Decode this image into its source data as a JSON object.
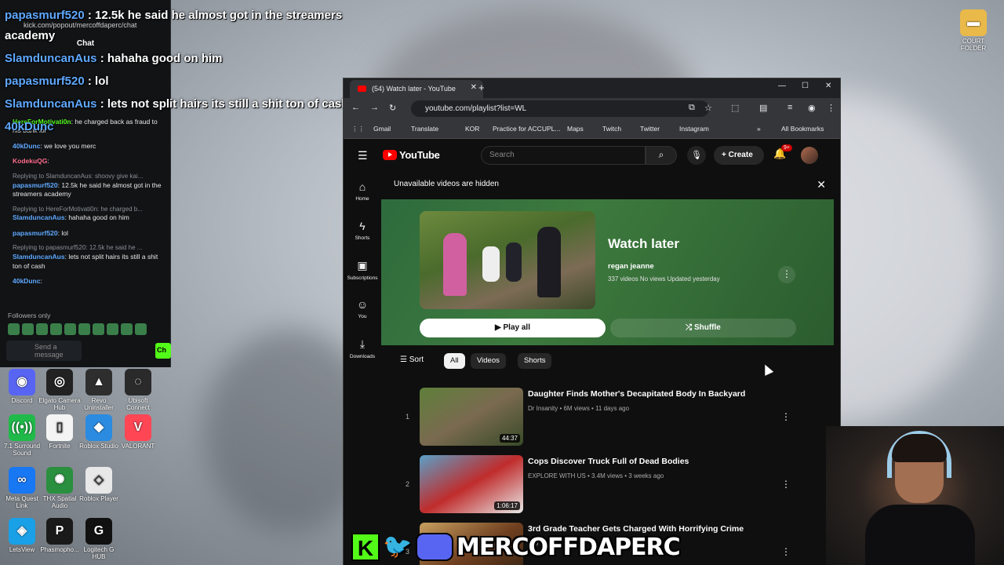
{
  "desktop": {
    "icons": [
      {
        "label": "COURT FOLDER",
        "glyph": "▬",
        "color": "#e9b949"
      },
      {
        "label": "Discord",
        "glyph": "◉",
        "color": "#5865f2"
      },
      {
        "label": "Elgato Camera Hub",
        "glyph": "◎",
        "color": "#222222"
      },
      {
        "label": "Revo Uninstaller",
        "glyph": "▲",
        "color": "#2e2e2e"
      },
      {
        "label": "Ubisoft Connect",
        "glyph": "◌",
        "color": "#2a2a2a"
      },
      {
        "label": "7.1 Surround Sound",
        "glyph": "((•))",
        "color": "#1fba4a"
      },
      {
        "label": "Fortnite",
        "glyph": "▯",
        "color": "#f4f4f4"
      },
      {
        "label": "Roblox Studio",
        "glyph": "◆",
        "color": "#2b8be0"
      },
      {
        "label": "VALORANT",
        "glyph": "V",
        "color": "#ff4655"
      },
      {
        "label": "Meta Quest Link",
        "glyph": "∞",
        "color": "#1877f2"
      },
      {
        "label": "THX Spatial Audio",
        "glyph": "✺",
        "color": "#2a8f3e"
      },
      {
        "label": "Roblox Player",
        "glyph": "◇",
        "color": "#e8e8e8"
      },
      {
        "label": "LetsView",
        "glyph": "◈",
        "color": "#1aa0e6"
      },
      {
        "label": "Phasmopho...",
        "glyph": "P",
        "color": "#1a1a1a"
      },
      {
        "label": "Logitech G HUB",
        "glyph": "G",
        "color": "#111111"
      }
    ]
  },
  "chat_popout": {
    "url": "kick.com/popout/mercoffdaperc/chat",
    "header": "Chat",
    "messages": [
      {
        "reply": "",
        "user": "HereForMotivati0n",
        "user_color": "#53fc18",
        "text": ": he charged back as fraud to his bank lol"
      },
      {
        "reply": "",
        "user": "40kDunc",
        "user_color": "#5fa8ff",
        "text": ": we love you merc"
      },
      {
        "reply": "",
        "user": "KodekuQG",
        "user_color": "#ff6b8a",
        "text": ":"
      },
      {
        "reply": "Replying to SlamduncanAus: shoovy give kai...",
        "user": "papasmurf520",
        "user_color": "#5fa8ff",
        "text": ": 12.5k he said he almost got in the streamers academy"
      },
      {
        "reply": "Replying to HereForMotivati0n: he charged b...",
        "user": "SlamduncanAus",
        "user_color": "#5fa8ff",
        "text": ": hahaha good on him"
      },
      {
        "reply": "",
        "user": "papasmurf520",
        "user_color": "#5fa8ff",
        "text": ": lol"
      },
      {
        "reply": "Replying to papasmurf520: 12.5k he said he ...",
        "user": "SlamduncanAus",
        "user_color": "#5fa8ff",
        "text": ": lets not split hairs its still a shit ton of cash"
      },
      {
        "reply": "",
        "user": "40kDunc",
        "user_color": "#5fa8ff",
        "text": ":"
      }
    ],
    "followers_only": "Followers only",
    "input_placeholder": "Send a message",
    "send_label": "Ch"
  },
  "overlay_chat": [
    {
      "user": "papasmurf520",
      "text": " : 12.5k he said he almost got in the streamers"
    },
    {
      "user": "",
      "text": "academy"
    },
    {
      "user": "SlamduncanAus",
      "text": " : hahaha good on him"
    },
    {
      "user": "papasmurf520",
      "text": " : lol"
    },
    {
      "user": "SlamduncanAus",
      "text": " : lets not split hairs its still a shit ton of cash"
    },
    {
      "user": "40kDunc",
      "text": ""
    }
  ],
  "browser": {
    "tab_title": "(54) Watch later - YouTube",
    "url": "youtube.com/playlist?list=WL",
    "bookmarks": [
      "Gmail",
      "Translate",
      "KOR",
      "Practice for ACCUPL...",
      "Maps",
      "Twitch",
      "Twitter",
      "Instagram",
      "All Bookmarks"
    ]
  },
  "youtube": {
    "logo": "YouTube",
    "search_placeholder": "Search",
    "create_label": "Create",
    "notifications": "9+",
    "sidebar": [
      {
        "icon": "home-icon",
        "glyph": "⌂",
        "label": "Home"
      },
      {
        "icon": "shorts-icon",
        "glyph": "ϟ",
        "label": "Shorts"
      },
      {
        "icon": "subscriptions-icon",
        "glyph": "▣",
        "label": "Subscriptions"
      },
      {
        "icon": "you-icon",
        "glyph": "☺",
        "label": "You"
      },
      {
        "icon": "downloads-icon",
        "glyph": "⤓",
        "label": "Downloads"
      }
    ],
    "notice": "Unavailable videos are hidden",
    "playlist": {
      "title": "Watch later",
      "owner": "regan jeanne",
      "meta": "337 videos  No views  Updated yesterday",
      "play_all": "Play all",
      "shuffle": "Shuffle"
    },
    "filters": {
      "sort": "Sort",
      "chips": [
        "All",
        "Videos",
        "Shorts"
      ],
      "active": "All"
    },
    "videos": [
      {
        "index": "1",
        "title": "Daughter Finds Mother's Decapitated Body In Backyard",
        "channel": "Dr Insanity",
        "meta": "6M views • 11 days ago",
        "duration": "44:37",
        "thumb": "linear-gradient(150deg,#5f7f3a,#7a6a50,#384a28)"
      },
      {
        "index": "2",
        "title": "Cops Discover Truck Full of Dead Bodies",
        "channel": "EXPLORE WITH US",
        "meta": "3.4M views • 3 weeks ago",
        "duration": "1:06:17",
        "thumb": "linear-gradient(150deg,#5aa0c8,#c02c2c,#e8e8e8)"
      },
      {
        "index": "3",
        "title": "3rd Grade Teacher Gets Charged With Horrifying Crime",
        "channel": "",
        "meta": "ago",
        "duration": "",
        "thumb": "linear-gradient(150deg,#c8a060,#704020,#302010)"
      }
    ]
  },
  "banner": {
    "kick": "K",
    "name": "MERCOFFDAPERC"
  }
}
